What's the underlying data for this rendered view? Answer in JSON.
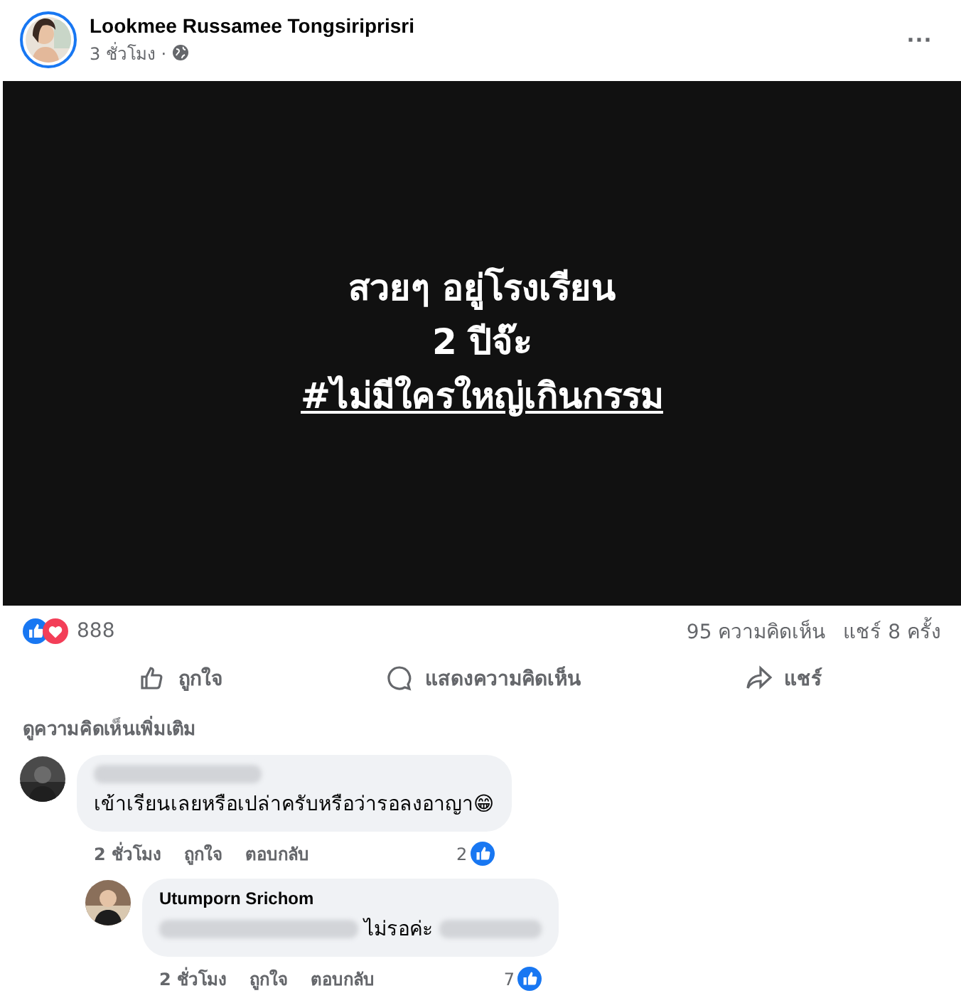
{
  "post": {
    "author": "Lookmee Russamee Tongsiriprisri",
    "time": "3 ชั่วโมง ·",
    "menu": "···"
  },
  "image_text": {
    "lines": [
      "สวยๆ อยู่โรงเรียน",
      "2 ปีจ๊ะ"
    ],
    "hashtag": "#ไม่มีใครใหญ่เกินกรรม"
  },
  "stats": {
    "reactions": "888",
    "comments": "95 ความคิดเห็น",
    "shares": "แชร์ 8 ครั้ง"
  },
  "actions": [
    {
      "kind": "like",
      "label": "ถูกใจ"
    },
    {
      "kind": "comment",
      "label": "แสดงความคิดเห็น"
    },
    {
      "kind": "share",
      "label": "แชร์"
    }
  ],
  "more_comments": "ดูความคิดเห็นเพิ่มเติม",
  "comments": [
    {
      "author_redacted": true,
      "text": "เข้าเรียนเลยหรือเปล่าครับหรือว่ารอลงอาญา😁",
      "time": "2 ชั่วโมง",
      "like": "ถูกใจ",
      "reply": "ตอบกลับ",
      "likes": "2",
      "children": [
        {
          "author": "Utumporn Srichom",
          "author_redacted": false,
          "text": "ไม่รอค่ะ",
          "time": "2 ชั่วโมง",
          "like": "ถูกใจ",
          "reply": "ตอบกลับ",
          "likes": "7"
        }
      ]
    }
  ]
}
